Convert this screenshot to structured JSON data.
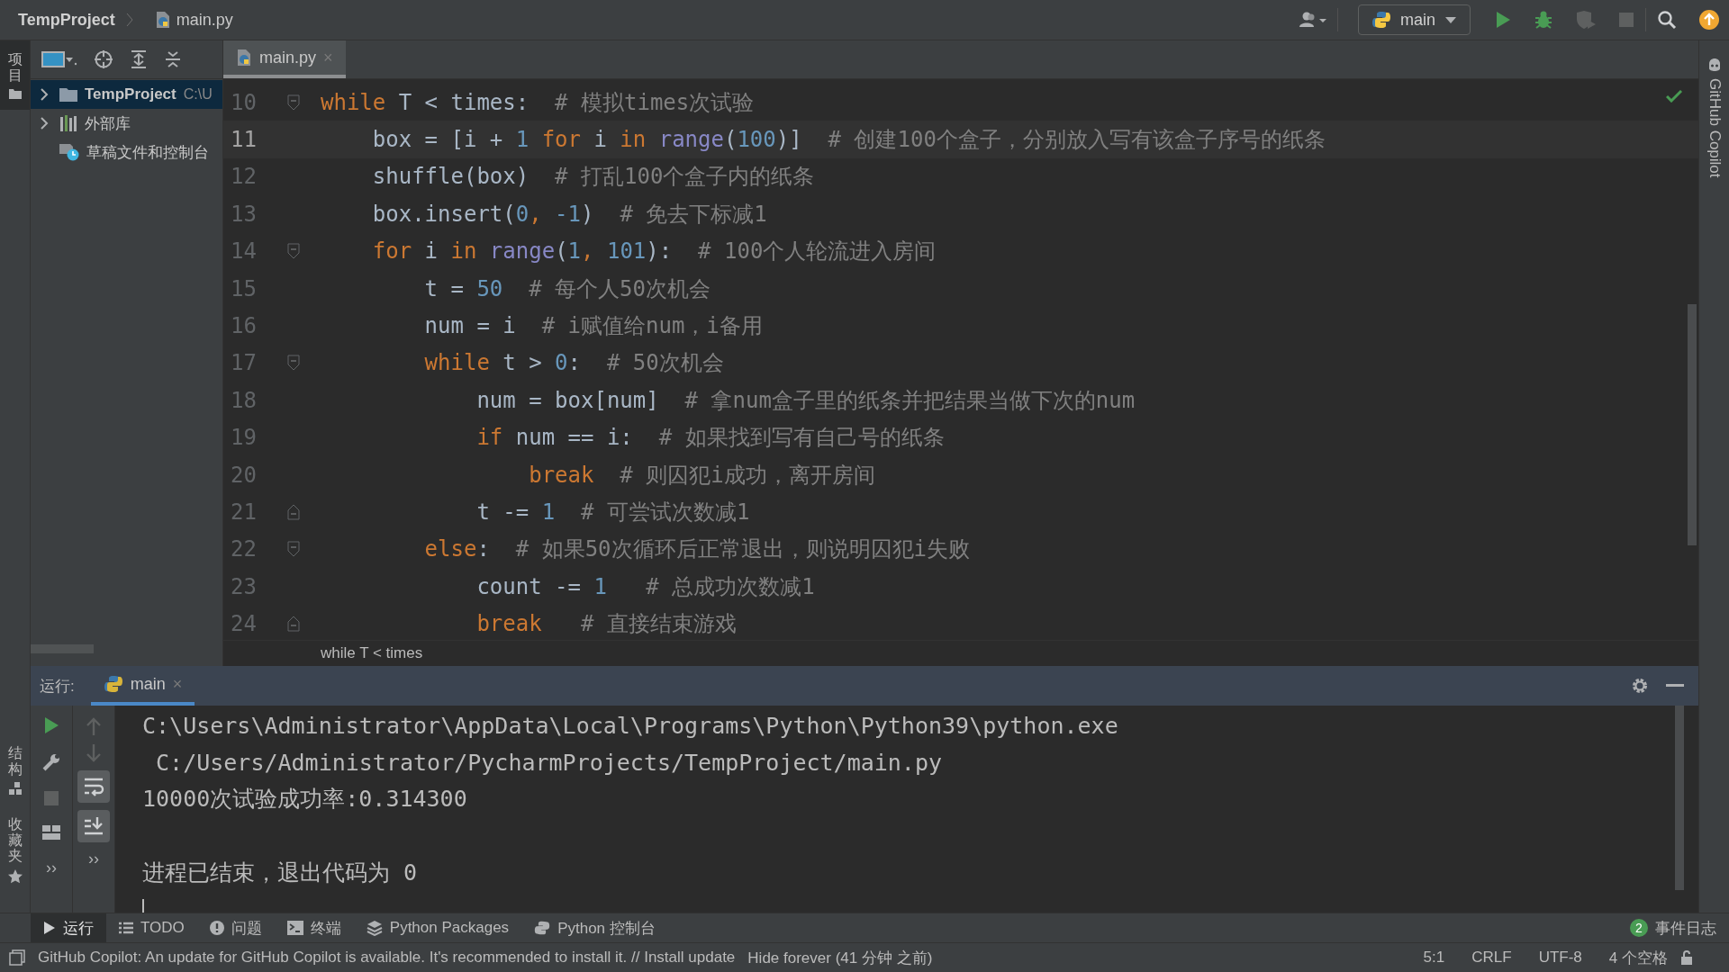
{
  "title_bar": {
    "project": "TempProject",
    "file": "main.py",
    "run_config": "main"
  },
  "left_strip": {
    "top": [
      {
        "label": "项目",
        "kind": "project",
        "selected": true
      }
    ],
    "bottom": [
      {
        "label": "结构",
        "kind": "structure",
        "selected": false
      },
      {
        "label": "收藏夹",
        "kind": "favorites",
        "selected": false
      }
    ]
  },
  "project_tree": [
    {
      "label": "TempProject",
      "path": "C:\\U",
      "kind": "folder",
      "expandable": true,
      "selected": true
    },
    {
      "label": "外部库",
      "kind": "library",
      "expandable": true,
      "selected": false
    },
    {
      "label": "草稿文件和控制台",
      "kind": "scratch",
      "expandable": false,
      "selected": false
    }
  ],
  "editor": {
    "tabs": [
      {
        "label": "main.py",
        "close": "×",
        "selected": true
      }
    ],
    "lines": [
      {
        "number": "10",
        "current": false,
        "fold_start": true,
        "fold_end": false,
        "tokens": [
          {
            "kind": "keyword",
            "text": "while"
          },
          {
            "kind": "text",
            "text": " T < times:  "
          },
          {
            "kind": "comment",
            "text": "# 模拟times次试验"
          }
        ]
      },
      {
        "number": "11",
        "current": true,
        "fold_start": false,
        "fold_end": false,
        "tokens": [
          {
            "kind": "text",
            "text": "    box = [i + "
          },
          {
            "kind": "number",
            "text": "1"
          },
          {
            "kind": "keyword",
            "text": " for"
          },
          {
            "kind": "text",
            "text": " i "
          },
          {
            "kind": "keyword",
            "text": "in"
          },
          {
            "kind": "builtin",
            "text": " range"
          },
          {
            "kind": "text",
            "text": "("
          },
          {
            "kind": "number",
            "text": "100"
          },
          {
            "kind": "text",
            "text": ")]  "
          },
          {
            "kind": "comment",
            "text": "# 创建100个盒子，分别放入写有该盒子序号的纸条"
          }
        ]
      },
      {
        "number": "12",
        "current": false,
        "fold_start": false,
        "fold_end": false,
        "tokens": [
          {
            "kind": "text",
            "text": "    shuffle(box)  "
          },
          {
            "kind": "comment",
            "text": "# 打乱100个盒子内的纸条"
          }
        ]
      },
      {
        "number": "13",
        "current": false,
        "fold_start": false,
        "fold_end": false,
        "tokens": [
          {
            "kind": "text",
            "text": "    box.insert("
          },
          {
            "kind": "number",
            "text": "0"
          },
          {
            "kind": "keyword",
            "text": ", "
          },
          {
            "kind": "number",
            "text": "-1"
          },
          {
            "kind": "text",
            "text": ")  "
          },
          {
            "kind": "comment",
            "text": "# 免去下标减1"
          }
        ]
      },
      {
        "number": "14",
        "current": false,
        "fold_start": true,
        "fold_end": false,
        "tokens": [
          {
            "kind": "keyword",
            "text": "    for"
          },
          {
            "kind": "text",
            "text": " i "
          },
          {
            "kind": "keyword",
            "text": "in"
          },
          {
            "kind": "builtin",
            "text": " range"
          },
          {
            "kind": "text",
            "text": "("
          },
          {
            "kind": "number",
            "text": "1"
          },
          {
            "kind": "keyword",
            "text": ", "
          },
          {
            "kind": "number",
            "text": "101"
          },
          {
            "kind": "text",
            "text": "):  "
          },
          {
            "kind": "comment",
            "text": "# 100个人轮流进入房间"
          }
        ]
      },
      {
        "number": "15",
        "current": false,
        "fold_start": false,
        "fold_end": false,
        "tokens": [
          {
            "kind": "text",
            "text": "        t = "
          },
          {
            "kind": "number",
            "text": "50"
          },
          {
            "kind": "comment",
            "text": "  # 每个人50次机会"
          }
        ]
      },
      {
        "number": "16",
        "current": false,
        "fold_start": false,
        "fold_end": false,
        "tokens": [
          {
            "kind": "text",
            "text": "        num = i  "
          },
          {
            "kind": "comment",
            "text": "# i赋值给num，i备用"
          }
        ]
      },
      {
        "number": "17",
        "current": false,
        "fold_start": true,
        "fold_end": false,
        "tokens": [
          {
            "kind": "keyword",
            "text": "        while"
          },
          {
            "kind": "text",
            "text": " t > "
          },
          {
            "kind": "number",
            "text": "0"
          },
          {
            "kind": "text",
            "text": ":  "
          },
          {
            "kind": "comment",
            "text": "# 50次机会"
          }
        ]
      },
      {
        "number": "18",
        "current": false,
        "fold_start": false,
        "fold_end": false,
        "tokens": [
          {
            "kind": "text",
            "text": "            num = box[num]  "
          },
          {
            "kind": "comment",
            "text": "# 拿num盒子里的纸条并把结果当做下次的num"
          }
        ]
      },
      {
        "number": "19",
        "current": false,
        "fold_start": false,
        "fold_end": false,
        "tokens": [
          {
            "kind": "keyword",
            "text": "            if"
          },
          {
            "kind": "text",
            "text": " num == i:  "
          },
          {
            "kind": "comment",
            "text": "# 如果找到写有自己号的纸条"
          }
        ]
      },
      {
        "number": "20",
        "current": false,
        "fold_start": false,
        "fold_end": false,
        "tokens": [
          {
            "kind": "keyword",
            "text": "                break"
          },
          {
            "kind": "comment",
            "text": "  # 则囚犯i成功，离开房间"
          }
        ]
      },
      {
        "number": "21",
        "current": false,
        "fold_start": false,
        "fold_end": true,
        "tokens": [
          {
            "kind": "text",
            "text": "            t -= "
          },
          {
            "kind": "number",
            "text": "1"
          },
          {
            "kind": "comment",
            "text": "  # 可尝试次数减1"
          }
        ]
      },
      {
        "number": "22",
        "current": false,
        "fold_start": true,
        "fold_end": false,
        "tokens": [
          {
            "kind": "keyword",
            "text": "        else"
          },
          {
            "kind": "text",
            "text": ":  "
          },
          {
            "kind": "comment",
            "text": "# 如果50次循环后正常退出，则说明囚犯i失败"
          }
        ]
      },
      {
        "number": "23",
        "current": false,
        "fold_start": false,
        "fold_end": false,
        "tokens": [
          {
            "kind": "text",
            "text": "            count -= "
          },
          {
            "kind": "number",
            "text": "1"
          },
          {
            "kind": "comment",
            "text": "   # 总成功次数减1"
          }
        ]
      },
      {
        "number": "24",
        "current": false,
        "fold_start": false,
        "fold_end": true,
        "tokens": [
          {
            "kind": "keyword",
            "text": "            break"
          },
          {
            "kind": "comment",
            "text": "   # 直接结束游戏"
          }
        ]
      }
    ],
    "breadcrumb": "while T < times"
  },
  "right_strip": {
    "label": "GitHub Copilot"
  },
  "run_panel": {
    "label": "运行:",
    "tabs": [
      {
        "label": "main",
        "close": "×",
        "selected": true
      }
    ],
    "toolbar_more": [
      "››",
      "››"
    ],
    "console": [
      {
        "kind": "output",
        "text": "C:\\Users\\Administrator\\AppData\\Local\\Programs\\Python\\Python39\\python.exe"
      },
      {
        "kind": "output",
        "text": " C:/Users/Administrator/PycharmProjects/TempProject/main.py"
      },
      {
        "kind": "output",
        "text": "10000次试验成功率:0.314300"
      },
      {
        "kind": "exit",
        "text": "进程已结束，退出代码为 0"
      }
    ]
  },
  "tool_tabs": [
    {
      "label": "运行",
      "kind": "run",
      "selected": true
    },
    {
      "label": "TODO",
      "kind": "todo",
      "selected": false
    },
    {
      "label": "问题",
      "kind": "problems",
      "selected": false
    },
    {
      "label": "终端",
      "kind": "terminal",
      "selected": false
    },
    {
      "label": "Python Packages",
      "kind": "packages",
      "selected": false
    },
    {
      "label": "Python 控制台",
      "kind": "console",
      "selected": false
    }
  ],
  "event_log": {
    "count": "2",
    "label": "事件日志"
  },
  "status_bar": {
    "message": "GitHub Copilot: An update for GitHub Copilot is available. It's recommended to install it. // Install update",
    "action": "Hide forever (41 分钟 之前)",
    "items": [
      "5:1",
      "CRLF",
      "UTF-8",
      "4 个空格"
    ]
  }
}
